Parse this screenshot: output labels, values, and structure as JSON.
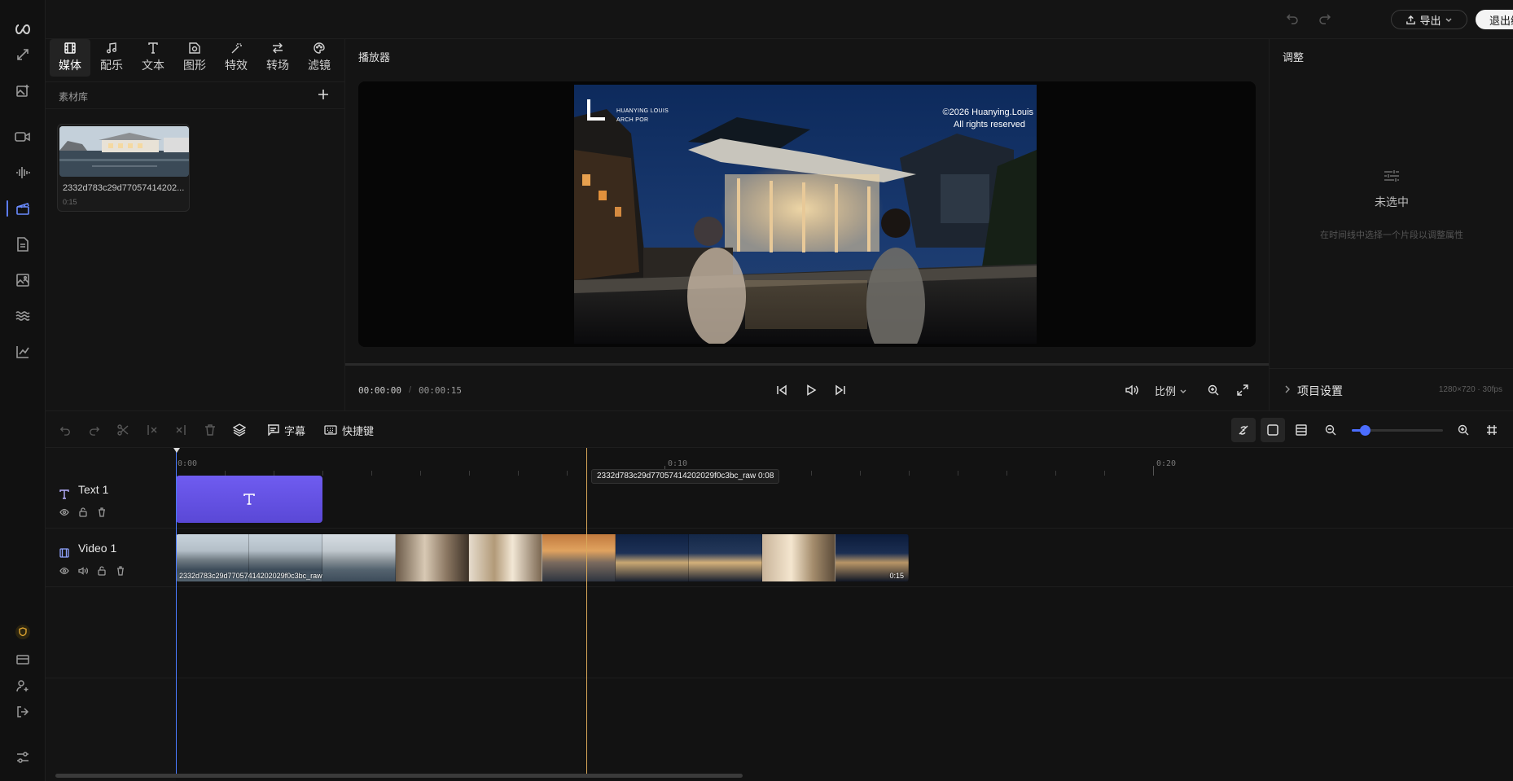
{
  "topbar": {
    "export_label": "导出",
    "exit_label": "退出编辑",
    "icons": [
      "undo-icon",
      "redo-icon",
      "upload-icon",
      "chevron-down-icon"
    ]
  },
  "rail": {
    "logo": "infinity-logo",
    "items": [
      "expand-icon",
      "image-plus-icon",
      "video-icon",
      "audio-wave-icon",
      "clapper-icon",
      "document-icon",
      "image-edit-icon",
      "waves-icon",
      "chart-line-icon"
    ],
    "active_item": "clapper-icon",
    "bottom": [
      "shield-icon",
      "card-icon",
      "user-settings-icon",
      "logout-icon",
      "sliders-icon"
    ]
  },
  "media_tabs": [
    {
      "label": "媒体",
      "icon": "film-icon",
      "active": true
    },
    {
      "label": "配乐",
      "icon": "music-icon"
    },
    {
      "label": "文本",
      "icon": "text-icon"
    },
    {
      "label": "图形",
      "icon": "shape-icon"
    },
    {
      "label": "特效",
      "icon": "magic-wand-icon"
    },
    {
      "label": "转场",
      "icon": "transition-icon"
    },
    {
      "label": "滤镜",
      "icon": "palette-icon"
    }
  ],
  "library": {
    "title": "素材库",
    "asset": {
      "name": "2332d783c29d77057414202...",
      "duration": "0:15"
    }
  },
  "player": {
    "title": "播放器",
    "current_time": "00:00:00",
    "separator": "/",
    "total_time": "00:00:15",
    "ratio_label": "比例",
    "progress": 0,
    "watermark": {
      "brand_line1": "HUANYING LOUIS",
      "brand_line2": "ARCH POR",
      "copyright_line1": "©2026 Huanying.Louis",
      "copyright_line2": "All rights reserved"
    }
  },
  "adjust": {
    "title": "调整",
    "empty_title": "未选中",
    "empty_hint": "在时间线中选择一个片段以调整属性",
    "project_settings": "项目设置",
    "project_meta": "1280×720 · 30fps"
  },
  "timeline_toolbar": {
    "subtitle_label": "字幕",
    "shortcut_label": "快捷键",
    "zoom_level": 0.14
  },
  "timeline": {
    "ruler": [
      "0:00",
      "0:10",
      "0:20"
    ],
    "tracks": [
      {
        "name": "Text 1",
        "type": "text"
      },
      {
        "name": "Video 1",
        "type": "video"
      }
    ],
    "video_clip_label": "2332d783c29d77057414202029f0c3bc_raw",
    "video_clip_duration": "0:15",
    "hover_tooltip": "2332d783c29d77057414202029f0c3bc_raw 0:08"
  }
}
